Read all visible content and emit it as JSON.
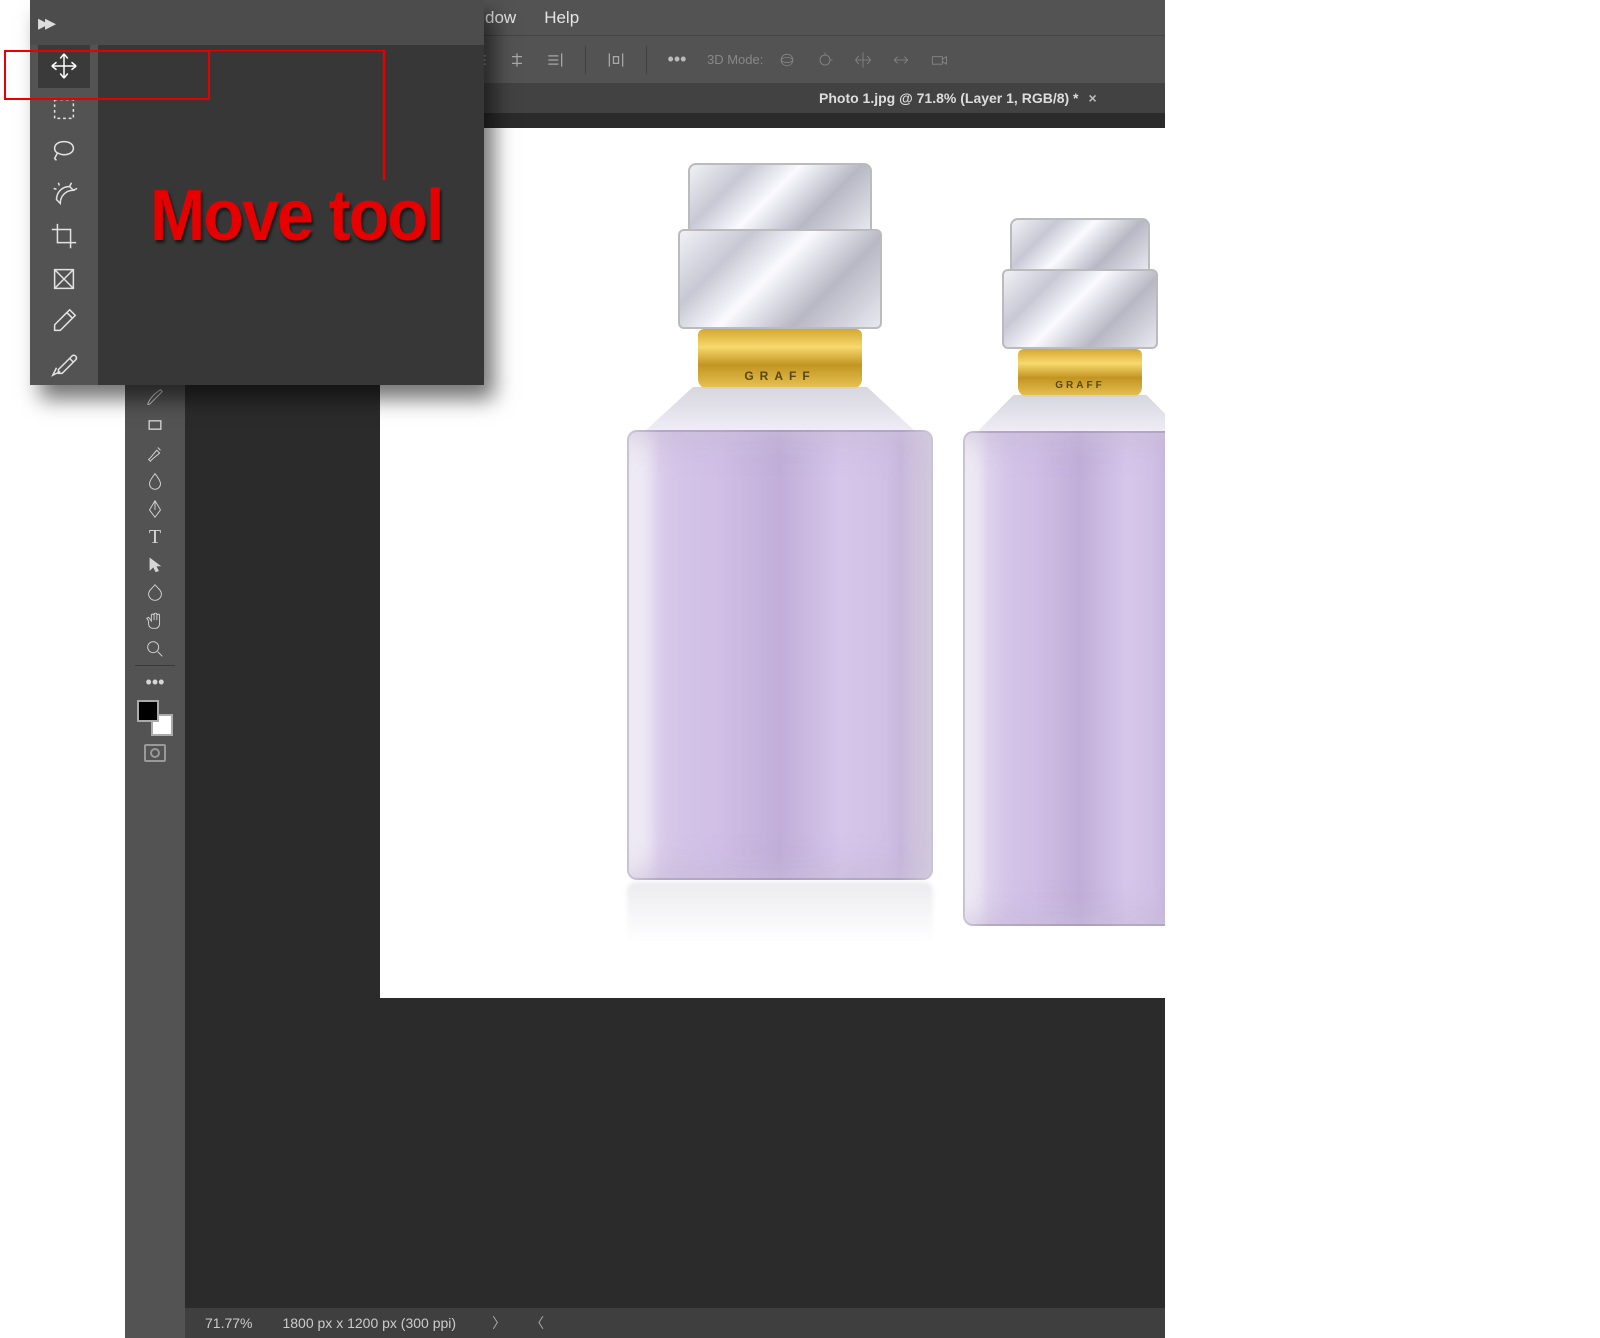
{
  "menubar": {
    "window": "dow",
    "help": "Help"
  },
  "optionsbar": {
    "mode3d": "3D Mode:"
  },
  "tab": {
    "title": "Photo 1.jpg @ 71.8% (Layer 1, RGB/8) *",
    "close": "×"
  },
  "statusbar": {
    "zoom": "71.77%",
    "docinfo": "1800 px x 1200 px (300 ppi)"
  },
  "annotation": {
    "label": "Move tool"
  },
  "product": {
    "brand": "GRAFF"
  },
  "overlay": {
    "collapse": "▸▸"
  }
}
